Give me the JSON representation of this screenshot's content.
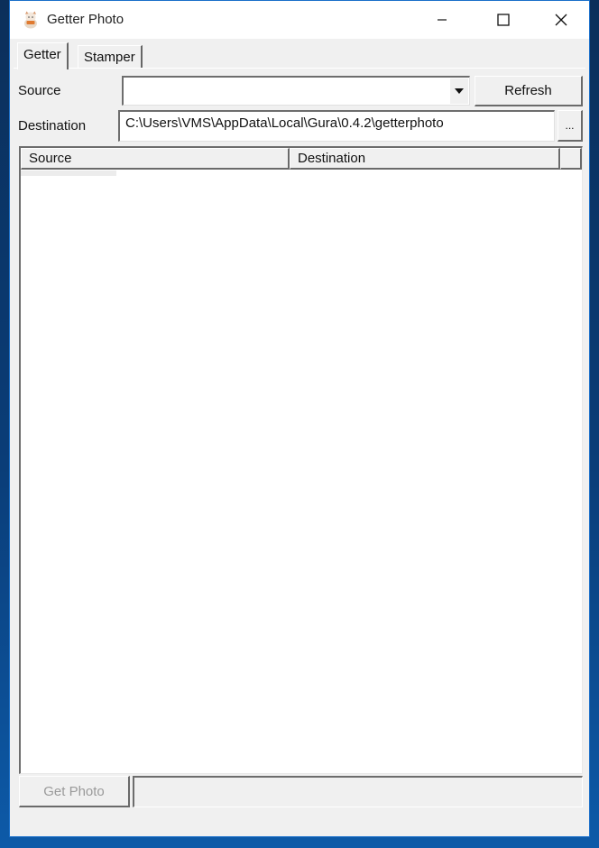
{
  "window": {
    "title": "Getter Photo",
    "app_icon": "lucky-cat-icon",
    "controls": {
      "minimize": "minimize-icon",
      "maximize": "maximize-icon",
      "close": "close-icon"
    }
  },
  "tabs": [
    {
      "label": "Getter",
      "active": true
    },
    {
      "label": "Stamper",
      "active": false
    }
  ],
  "getter": {
    "source_label": "Source",
    "source_value": "",
    "refresh_label": "Refresh",
    "destination_label": "Destination",
    "destination_value": "C:\\Users\\VMS\\AppData\\Local\\Gura\\0.4.2\\getterphoto",
    "browse_label": "...",
    "list": {
      "columns": [
        "Source",
        "Destination"
      ],
      "rows": []
    },
    "get_photo_label": "Get Photo",
    "get_photo_enabled": false,
    "status_text": ""
  }
}
